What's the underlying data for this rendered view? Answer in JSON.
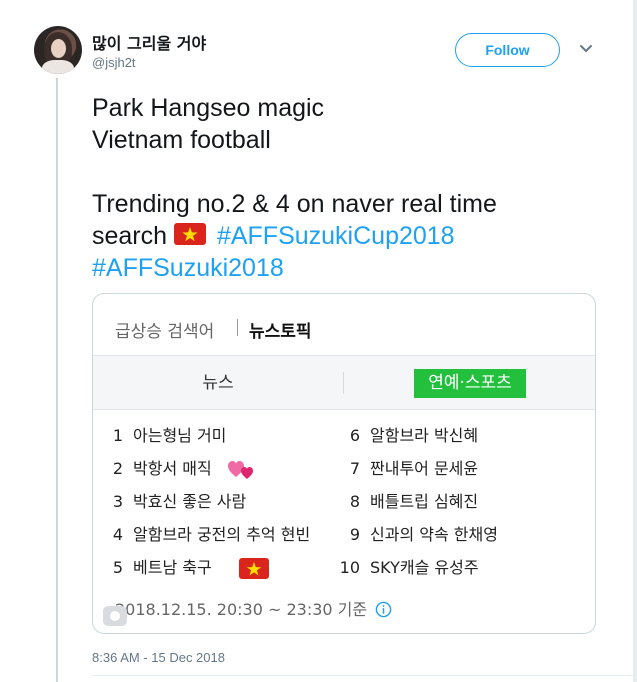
{
  "user": {
    "display_name": "많이 그리울 거야",
    "handle": "@jsjh2t"
  },
  "follow_label": "Follow",
  "tweet": {
    "line1": "Park Hangseo magic",
    "line2": "Vietnam football",
    "line3": "Trending no.2 & 4 on naver real time",
    "line4_text": "search",
    "hashtag1": "#AFFSuzukiCup2018",
    "hashtag2": "#AFFSuzuki2018"
  },
  "card": {
    "tab_rising": "급상승 검색어",
    "tab_news_topic": "뉴스토픽",
    "subtab_news": "뉴스",
    "subtab_entertainment": "연예·스포츠",
    "items": [
      {
        "rank": "1",
        "text": "아는형님 거미"
      },
      {
        "rank": "2",
        "text": "박항서 매직"
      },
      {
        "rank": "3",
        "text": "박효신 좋은 사람"
      },
      {
        "rank": "4",
        "text": "알함브라 궁전의 추억 현빈"
      },
      {
        "rank": "5",
        "text": "베트남 축구"
      },
      {
        "rank": "6",
        "text": "알함브라 박신혜"
      },
      {
        "rank": "7",
        "text": "짠내투어 문세윤"
      },
      {
        "rank": "8",
        "text": "배틀트립 심혜진"
      },
      {
        "rank": "9",
        "text": "신과의 약속 한채영"
      },
      {
        "rank": "10",
        "text": "SKY캐슬 유성주"
      }
    ],
    "time_range": "2018.12.15. 20:30 ~ 23:30 기준"
  },
  "timestamp": "8:36 AM - 15 Dec 2018",
  "colors": {
    "accent": "#1da1f2",
    "naver_green": "#22c03d",
    "flag_red": "#da251d",
    "flag_star": "#ffde00"
  },
  "icons": [
    "chevron-down-icon",
    "vietnam-flag-icon",
    "hearts-icon",
    "info-icon",
    "camera-icon"
  ]
}
